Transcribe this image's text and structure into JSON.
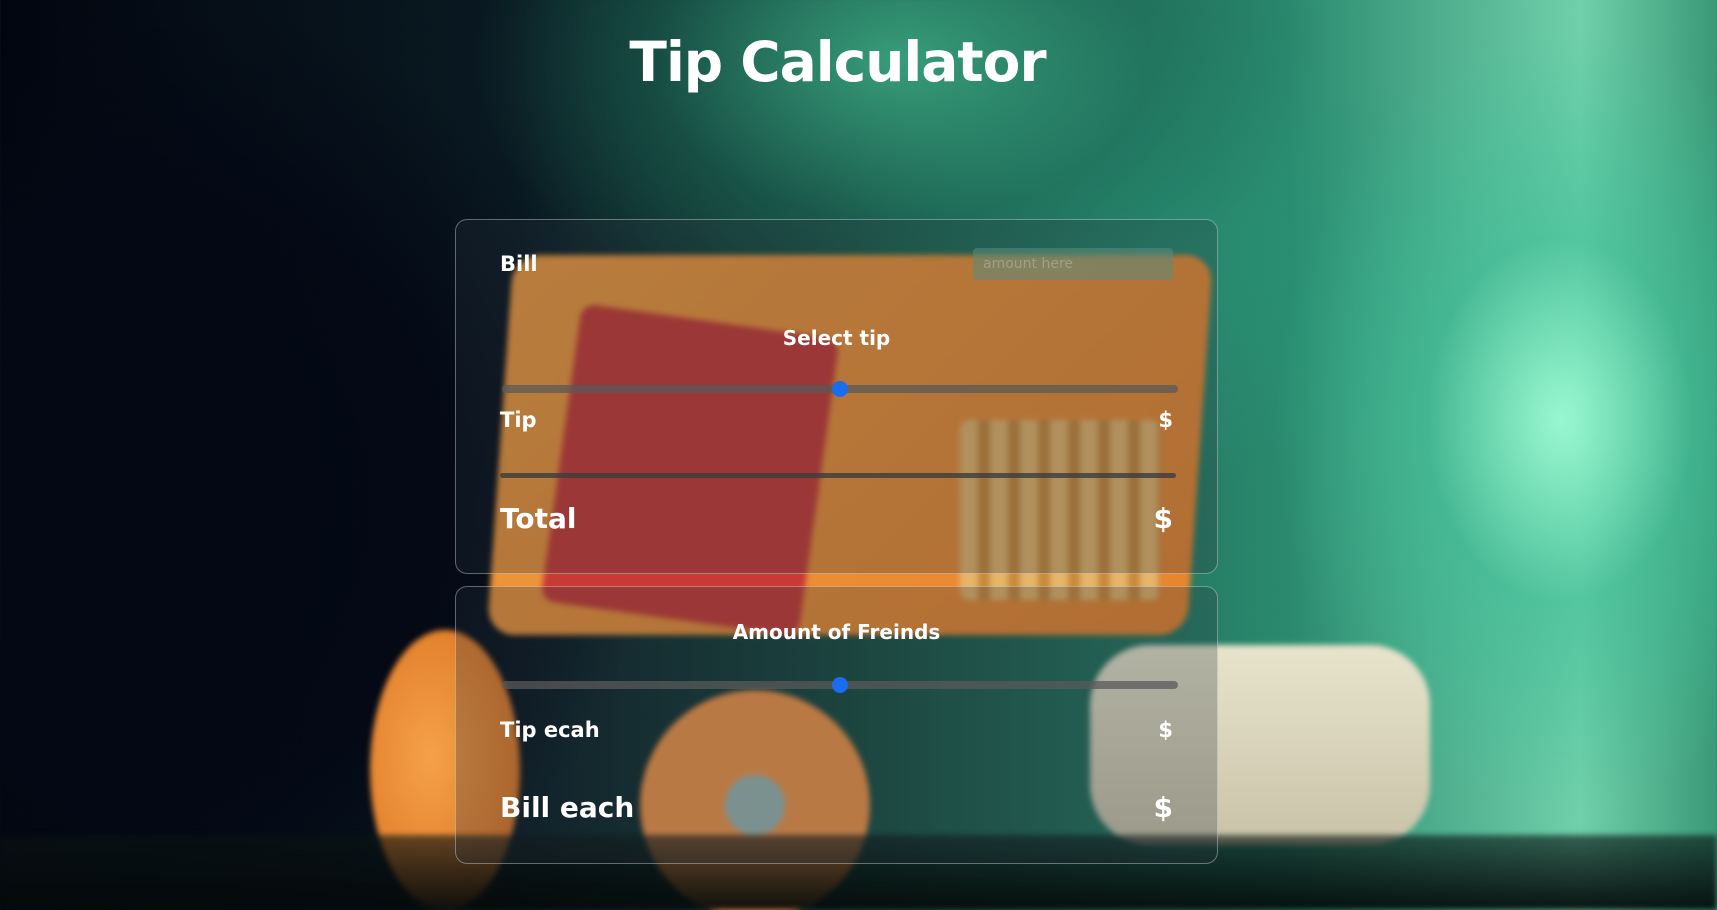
{
  "app": {
    "title": "Tip Calculator"
  },
  "bill_card": {
    "bill_label": "Bill",
    "bill_placeholder": "amount here",
    "bill_value": "",
    "select_tip_label": "Select tip",
    "tip_slider_percent": 50,
    "tip_label": "Tip",
    "tip_value": "$",
    "total_label": "Total",
    "total_value": "$"
  },
  "friends_card": {
    "friends_label": "Amount of Freinds",
    "friends_slider_percent": 50,
    "tip_each_label": "Tip ecah",
    "tip_each_value": "$",
    "bill_each_label": "Bill each",
    "bill_each_value": "$"
  },
  "colors": {
    "slider_thumb": "#1a6cf0",
    "text": "#ffffff"
  }
}
